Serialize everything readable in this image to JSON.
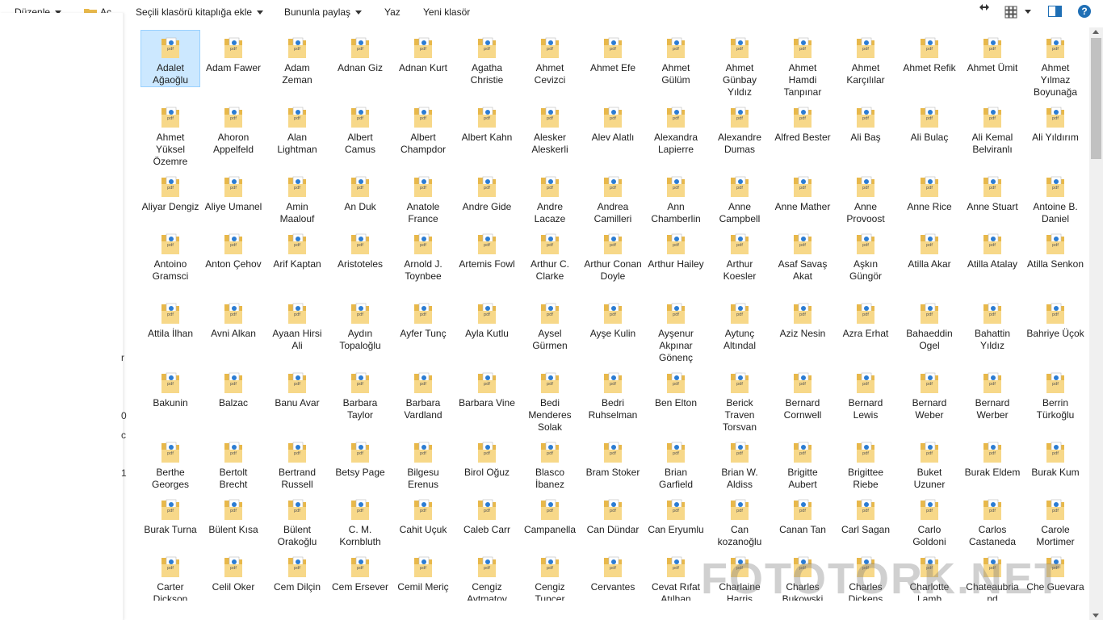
{
  "toolbar": {
    "organize": "Düzenle",
    "open": "Aç",
    "add_library": "Seçili klasörü kitaplığa ekle",
    "share": "Bununla paylaş",
    "burn": "Yaz",
    "new_folder": "Yeni klasör"
  },
  "icons": {
    "resize": "resize-arrows-icon",
    "view": "view-options-icon",
    "preview": "preview-pane-icon",
    "help": "help-icon",
    "help_glyph": "?"
  },
  "sidebar_marks": [
    "r",
    "0",
    "c",
    "1"
  ],
  "watermark": "FOTOTORK.NET",
  "selected_index": 0,
  "folders": [
    "Adalet Ağaoğlu",
    "Adam Fawer",
    "Adam Zeman",
    "Adnan Giz",
    "Adnan Kurt",
    "Agatha Christie",
    "Ahmet Cevizci",
    "Ahmet Efe",
    "Ahmet Gülüm",
    "Ahmet Günbay Yıldız",
    "Ahmet Hamdi Tanpınar",
    "Ahmet Karçılılar",
    "Ahmet Refik",
    "Ahmet Ümit",
    "Ahmet Yılmaz Boyunağa",
    "Ahmet Yüksel Özemre",
    "Ahoron Appelfeld",
    "Alan Lightman",
    "Albert Camus",
    "Albert Champdor",
    "Albert Kahn",
    "Alesker Aleskerli",
    "Alev Alatlı",
    "Alexandra Lapierre",
    "Alexandre Dumas",
    "Alfred Bester",
    "Ali Baş",
    "Ali Bulaç",
    "Ali Kemal Belviranlı",
    "Ali Yıldırım",
    "Aliyar Dengiz",
    "Aliye Umanel",
    "Amin Maalouf",
    "An Duk",
    "Anatole France",
    "Andre Gide",
    "Andre Lacaze",
    "Andrea Camilleri",
    "Ann Chamberlin",
    "Anne Campbell",
    "Anne Mather",
    "Anne Provoost",
    "Anne Rice",
    "Anne Stuart",
    "Antoine B. Daniel",
    "Antoino Gramsci",
    "Anton Çehov",
    "Arif Kaptan",
    "Aristoteles",
    "Arnold J. Toynbee",
    "Artemis Fowl",
    "Arthur C. Clarke",
    "Arthur Conan Doyle",
    "Arthur Hailey",
    "Arthur Koesler",
    "Asaf Savaş Akat",
    "Aşkın Güngör",
    "Atilla Akar",
    "Atilla Atalay",
    "Atilla Senkon",
    "Attila İlhan",
    "Avni Alkan",
    "Ayaan Hirsi Ali",
    "Aydın Topaloğlu",
    "Ayfer Tunç",
    "Ayla Kutlu",
    "Aysel Gürmen",
    "Ayşe Kulin",
    "Ayşenur Akpınar Gönenç",
    "Aytunç Altındal",
    "Aziz Nesin",
    "Azra Erhat",
    "Bahaeddin Ogel",
    "Bahattin Yıldız",
    "Bahriye Üçok",
    "Bakunin",
    "Balzac",
    "Banu Avar",
    "Barbara Taylor",
    "Barbara Vardland",
    "Barbara Vine",
    "Bedi Menderes Solak",
    "Bedri Ruhselman",
    "Ben Elton",
    "Berick Traven Torsvan",
    "Bernard Cornwell",
    "Bernard Lewis",
    "Bernard Weber",
    "Bernard Werber",
    "Berrin Türkoğlu",
    "Berthe Georges",
    "Bertolt Brecht",
    "Bertrand Russell",
    "Betsy Page",
    "Bilgesu Erenus",
    "Birol Oğuz",
    "Blasco İbanez",
    "Bram Stoker",
    "Brian Garfield",
    "Brian W. Aldiss",
    "Brigitte Aubert",
    "Brigittee Riebe",
    "Buket Uzuner",
    "Burak Eldem",
    "Burak Kum",
    "Burak Turna",
    "Bülent Kısa",
    "Bülent Orakoğlu",
    "C. M. Kornbluth",
    "Cahit Uçuk",
    "Caleb Carr",
    "Campanella",
    "Can Dündar",
    "Can Eryumlu",
    "Can kozanoğlu",
    "Canan Tan",
    "Carl Sagan",
    "Carlo Goldoni",
    "Carlos Castaneda",
    "Carole Mortimer",
    "Carter Dickson",
    "Celil Oker",
    "Cem Dilçin",
    "Cem Ersever",
    "Cemil Meriç",
    "Cengiz Aytmatov",
    "Cengiz Tuncer",
    "Cervantes",
    "Cevat Rıfat Atılhan",
    "Charlaine Harris",
    "Charles Bukowski",
    "Charles Dickens",
    "Charlotte Lamb",
    "Chateaubriand",
    "Che Guevara"
  ]
}
